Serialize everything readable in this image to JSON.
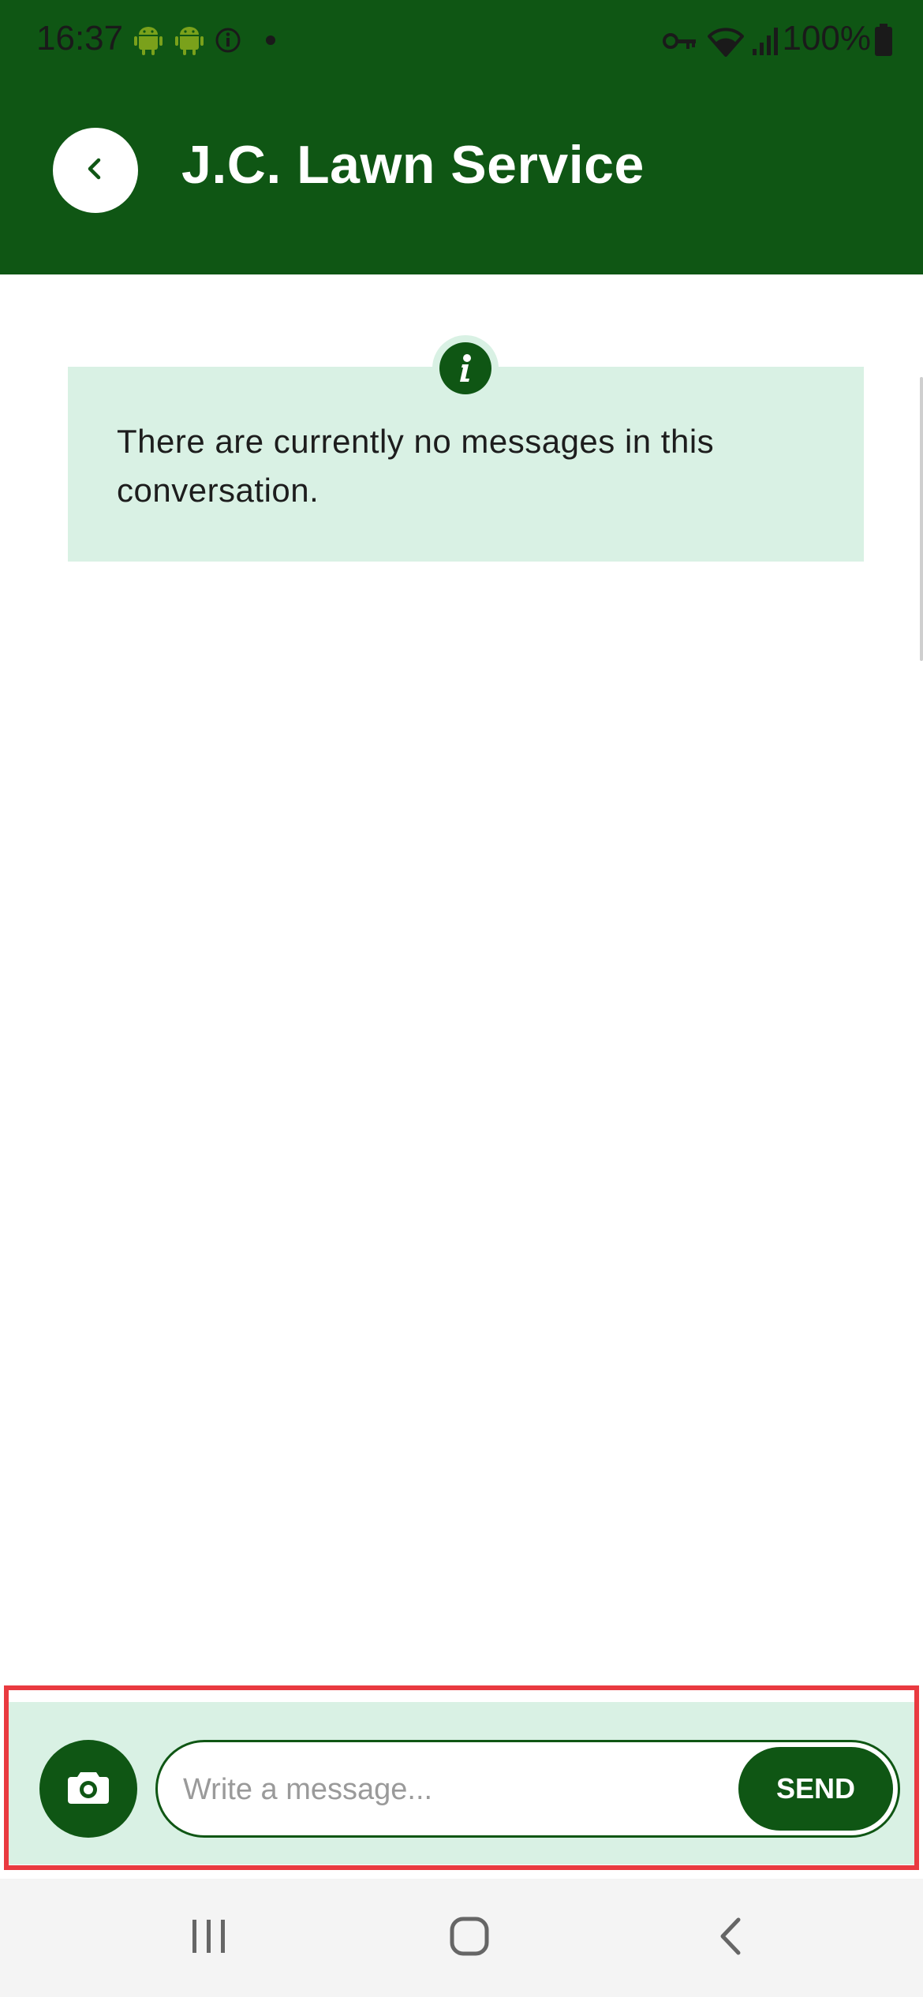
{
  "status_bar": {
    "time": "16:37",
    "battery": "100%",
    "icons": [
      "android-icon",
      "android-icon",
      "info-circle-icon",
      "dot-icon",
      "key-icon",
      "wifi-icon",
      "signal-icon",
      "battery-icon"
    ]
  },
  "header": {
    "title": "J.C. Lawn Service",
    "back_icon": "chevron-left-icon"
  },
  "info_box": {
    "icon": "info-icon",
    "message": "There are currently no messages in this conversation."
  },
  "composer": {
    "camera_icon": "camera-icon",
    "placeholder": "Write a message...",
    "value": "",
    "send_label": "SEND"
  },
  "nav_bar": {
    "buttons": [
      "recent-apps-icon",
      "home-icon",
      "back-icon"
    ]
  },
  "colors": {
    "primary": "#0f5614",
    "info_bg": "#d9f1e4",
    "highlight_outline": "#e93a40"
  }
}
